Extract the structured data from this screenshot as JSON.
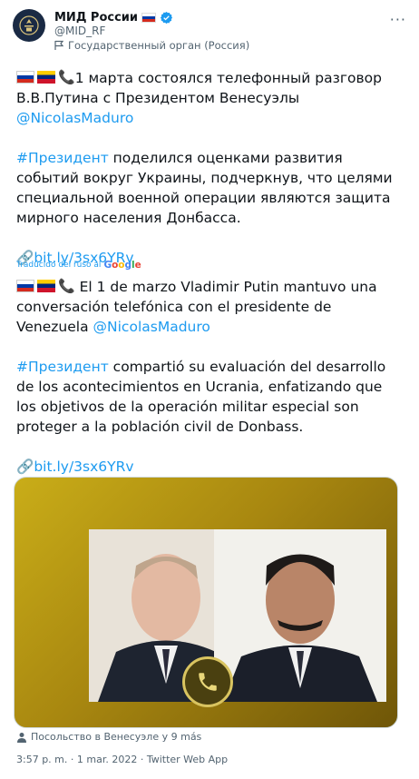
{
  "account": {
    "display_name": "МИД России",
    "handle": "@MID_RF",
    "label": "Государственный орган (Россия)"
  },
  "tweet": {
    "ru_line1": "1 марта состоялся телефонный разговор В.В.Путина с Президентом Венесуэлы ",
    "ru_mention": "@NicolasMaduro",
    "ru_hashtag": "#Президент",
    "ru_para2": " поделился оценками развития событий вокруг Украины, подчеркнув, что целями специальной военной операции являются защита мирного населения Донбасса.",
    "ru_link": "bit.ly/3sx6YRv",
    "translated_label": "Traducido del ruso al",
    "google": [
      "G",
      "o",
      "o",
      "g",
      "l",
      "e"
    ],
    "es_line1": " El 1 de marzo Vladimir Putin mantuvo una conversación telefónica con el presidente de Venezuela ",
    "es_mention": "@NicolasMaduro",
    "es_hashtag": "#Президент",
    "es_para2": " compartió su evaluación del desarrollo de los acontecimientos en Ucrania, enfatizando que los objetivos de la operación militar especial son proteger a la población civil de Donbass.",
    "es_link": "bit.ly/3sx6YRv"
  },
  "media_location": "Посольство в Венесуэле у 9 más",
  "timestamp": "3:57 p. m. · 1 mar. 2022 · Twitter Web App",
  "colors": {
    "link": "#1d9bf0",
    "verified": "#1d9bf0",
    "media_bg": "#b89a14"
  },
  "icons": [
    "verified-badge-icon",
    "flag-russia-icon",
    "flag-venezuela-icon",
    "telephone-icon",
    "link-icon",
    "government-label-icon",
    "person-tag-icon",
    "more-icon"
  ]
}
